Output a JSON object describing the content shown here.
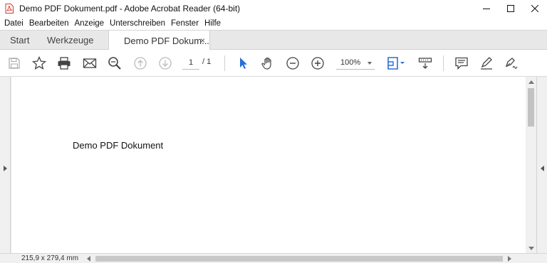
{
  "window": {
    "title": "Demo PDF Dokument.pdf - Adobe Acrobat Reader (64-bit)",
    "icon": "acrobat-pdf-icon",
    "accent_color": "#d4382c"
  },
  "menu": {
    "items": [
      "Datei",
      "Bearbeiten",
      "Anzeige",
      "Unterschreiben",
      "Fenster",
      "Hilfe"
    ]
  },
  "tabs": {
    "start": "Start",
    "tools": "Werkzeuge",
    "document": "Demo PDF Dokum...",
    "close": "×"
  },
  "toolbar": {
    "page_current": "1",
    "page_total": "/ 1",
    "zoom": "100%",
    "icons": [
      "save-icon",
      "star-icon",
      "print-icon",
      "mail-icon",
      "search-zoom-icon",
      "page-up-icon",
      "page-down-icon",
      "select-cursor-icon",
      "hand-icon",
      "zoom-out-icon",
      "zoom-in-icon",
      "fit-page-icon",
      "scroll-mode-icon",
      "comment-icon",
      "highlight-icon",
      "sign-icon"
    ],
    "active_color": "#2a6fd6"
  },
  "document": {
    "text": "Demo PDF Dokument"
  },
  "status": {
    "page_size": "215,9 x 279,4 mm"
  }
}
